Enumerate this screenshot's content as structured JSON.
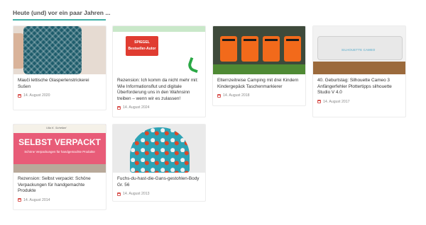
{
  "section": {
    "title": "Heute (und) vor ein paar Jahren ..."
  },
  "thumbs": {
    "book": {
      "badge": "SPIEGEL Bestseller-Autor"
    },
    "cameo": {
      "brand": "SILHOUETTE CAMEO"
    },
    "pack": {
      "author": "Ulla K. Scheibel",
      "headline": "SELBST VERPACKT",
      "tagline": "Schöne Verpackungen für handgemachte Produkte"
    }
  },
  "posts": [
    {
      "title": "Mauči lettische Glasperlenstrickerei Sušen",
      "date": "14. August 2020"
    },
    {
      "title": "Rezension: Ich komm da nicht mehr mit: Wie Informationsflut und digitale Überforderung uns in den Wahnsinn treiben – wenn wir es zulassen!",
      "date": "14. August 2024"
    },
    {
      "title": "Elternzeitreise Camping mit drei Kindern Kindergepäck Taschenmarkierer",
      "date": "14. August 2018"
    },
    {
      "title": "40. Geburtstag: Silhouette Cameo 3 Anfängerfehler Plottertipps silhouette Studio V 4.0",
      "date": "14. August 2017"
    },
    {
      "title": "Rezension: Selbst verpackt: Schöne Verpackungen für handgemachte Produkte",
      "date": "14. August 2014"
    },
    {
      "title": "Fuchs-du-hast-die-Gans-gestohlen-Body Gr. 56",
      "date": "14. August 2013"
    }
  ],
  "colors": {
    "accent_rule": "#3fb0a8",
    "calendar_icon": "#d9534f"
  }
}
